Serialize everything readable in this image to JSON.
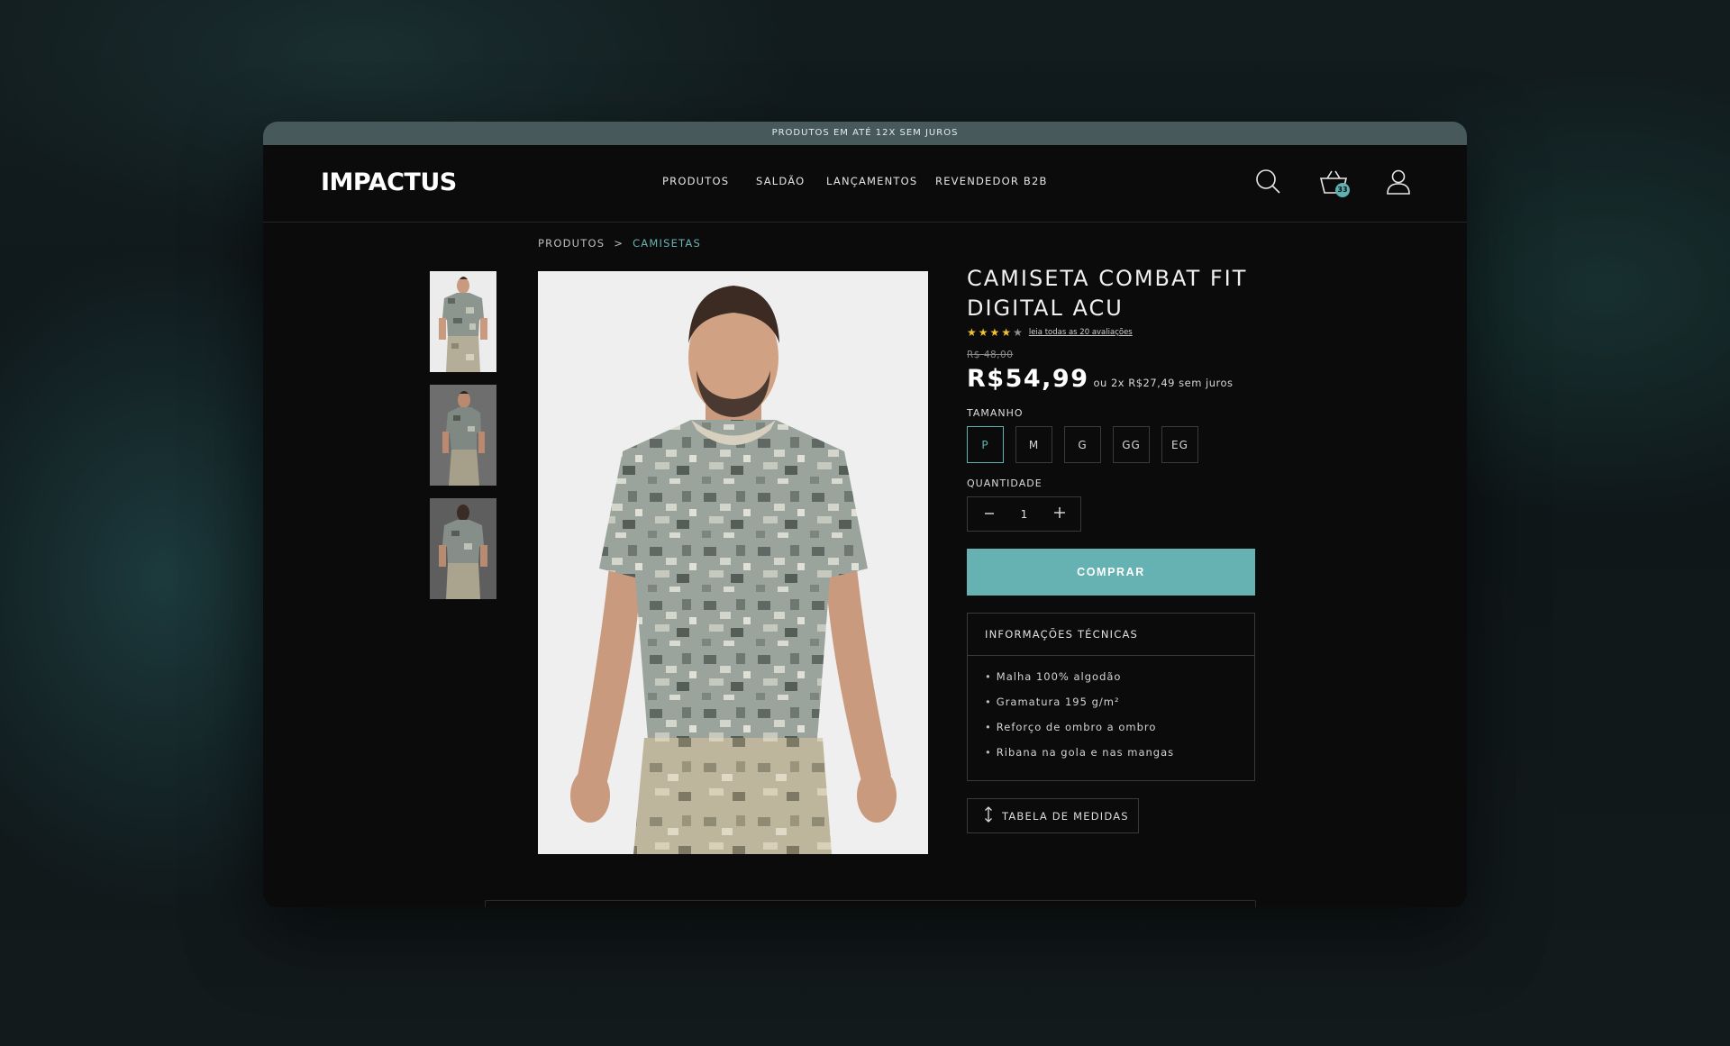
{
  "promo": {
    "text": "PRODUTOS EM ATÉ 12X SEM JUROS"
  },
  "header": {
    "logo": "IMPACTUS",
    "nav": [
      "PRODUTOS",
      "SALDÃO",
      "LANÇAMENTOS",
      "REVENDEDOR B2B"
    ],
    "icons": [
      "search-icon",
      "cart-icon",
      "user-icon"
    ],
    "cart_count": "33"
  },
  "breadcrumb": {
    "root": "PRODUTOS",
    "separator": ">",
    "current": "CAMISETAS"
  },
  "product": {
    "title": "CAMISETA COMBAT FIT DIGITAL ACU",
    "rating": 4,
    "rating_max": 5,
    "reviews_link": "leia todas as 20 avaliações",
    "old_price": "R$ 48,00",
    "price": "R$54,99",
    "installment": "ou 2x R$27,49 sem juros",
    "size_label": "TAMANHO",
    "sizes": [
      "P",
      "M",
      "G",
      "GG",
      "EG"
    ],
    "selected_size": "P",
    "quantity_label": "QUANTIDADE",
    "quantity": "1",
    "buy_label": "COMPRAR",
    "tech_title": "INFORMAÇÕES TÉCNICAS",
    "tech_items": [
      "Malha 100% algodão",
      "Gramatura 195 g/m²",
      "Reforço de ombro a ombro",
      "Ribana na gola e nas mangas"
    ],
    "measure_label": "TABELA DE MEDIDAS"
  },
  "colors": {
    "accent": "#66b1b2",
    "promo_bar": "#47595b",
    "background": "#0b0b0b",
    "star": "#f1c232"
  }
}
